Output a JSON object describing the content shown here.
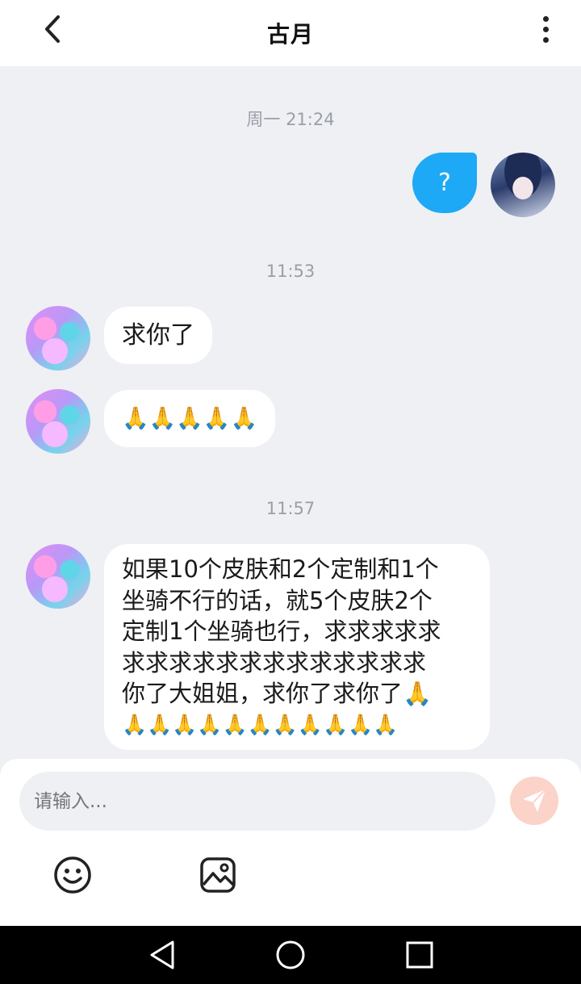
{
  "header": {
    "title": "古月",
    "back_icon": "chevron-left-icon",
    "more_icon": "more-vertical-icon"
  },
  "messages": {
    "time_1": "周一 21:24",
    "sent_1": "?",
    "time_2": "11:53",
    "recv_1": "求你了",
    "recv_2": "🙏🙏🙏🙏🙏",
    "time_3": "11:57",
    "recv_3_lines": [
      "如果10个皮肤和2个定制和1个",
      "坐骑不行的话，就5个皮肤2个",
      "定制1个坐骑也行，求求求求求",
      "求求求求求求求求求求求求求",
      "你了大姐姐，求你了求你了🙏",
      "🙏🙏🙏🙏🙏🙏🙏🙏🙏🙏🙏"
    ]
  },
  "composer": {
    "placeholder": "请输入...",
    "send_icon": "send-icon",
    "emoji_icon": "emoji-smile-icon",
    "image_icon": "image-icon"
  },
  "system_nav": {
    "back": "back-triangle-icon",
    "home": "home-circle-icon",
    "recents": "recents-square-icon"
  },
  "colors": {
    "sent_bubble": "#1ea9f6",
    "background": "#eef0f4",
    "send_button": "#fbd3c8"
  }
}
